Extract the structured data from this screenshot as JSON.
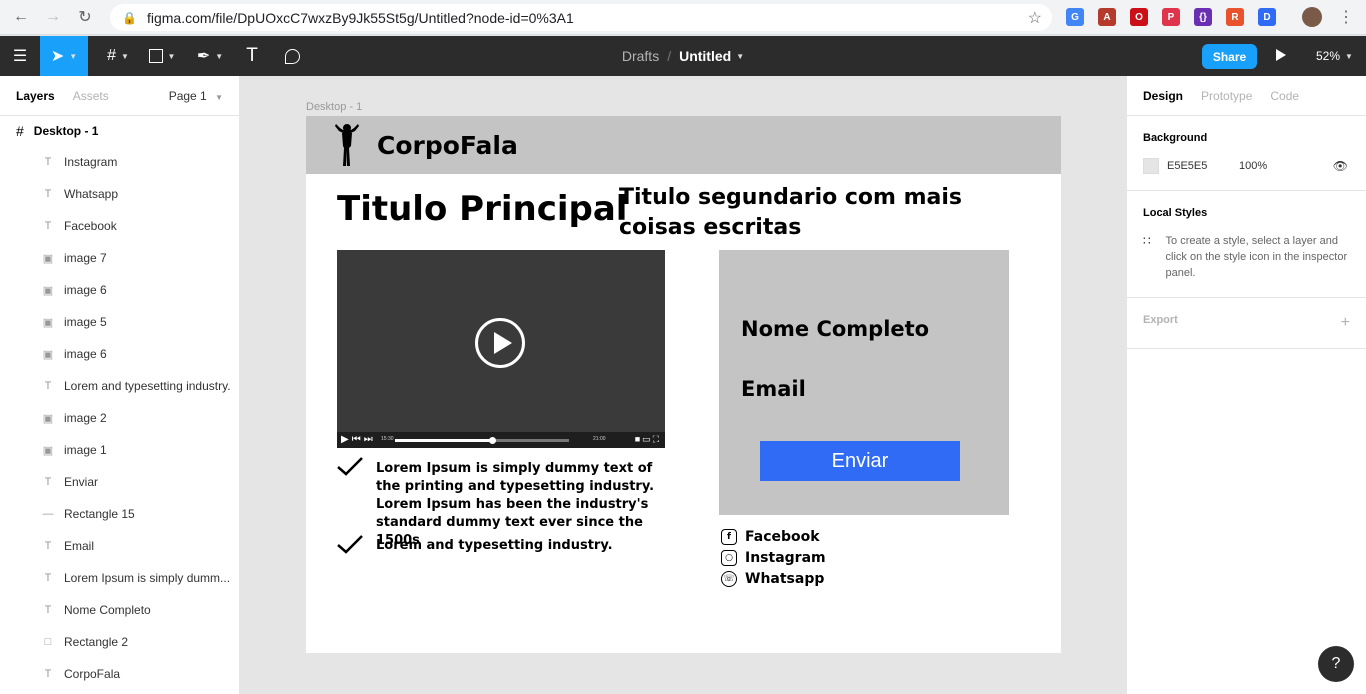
{
  "browser": {
    "url": "figma.com/file/DpUOxcC7wxzBy9Jk55St5g/Untitled?node-id=0%3A1",
    "extensions": [
      {
        "name": "translate-icon",
        "color": "#4285f4",
        "glyph": "G"
      },
      {
        "name": "pdf-icon",
        "color": "#b53a2b",
        "glyph": "A"
      },
      {
        "name": "opera-icon",
        "color": "#cc0f16",
        "glyph": "O"
      },
      {
        "name": "pocket-icon",
        "color": "#e0334c",
        "glyph": "P"
      },
      {
        "name": "json-icon",
        "color": "#6b2fb3",
        "glyph": "{}"
      },
      {
        "name": "rocket-icon",
        "color": "#e8532d",
        "glyph": "R"
      },
      {
        "name": "screen-icon",
        "color": "#2f6bf5",
        "glyph": "D"
      }
    ]
  },
  "toolbar": {
    "drafts": "Drafts",
    "file_title": "Untitled",
    "share_label": "Share",
    "zoom": "52%"
  },
  "left_panel": {
    "tabs": [
      "Layers",
      "Assets"
    ],
    "page": "Page 1",
    "frame": "Desktop - 1",
    "layers": [
      {
        "type": "text",
        "label": "Instagram"
      },
      {
        "type": "text",
        "label": "Whatsapp"
      },
      {
        "type": "text",
        "label": "Facebook"
      },
      {
        "type": "image",
        "label": "image 7"
      },
      {
        "type": "image",
        "label": "image 6"
      },
      {
        "type": "image",
        "label": "image 5"
      },
      {
        "type": "image",
        "label": "image 6"
      },
      {
        "type": "text",
        "label": "Lorem and typesetting industry."
      },
      {
        "type": "image",
        "label": "image 2"
      },
      {
        "type": "image",
        "label": "image 1"
      },
      {
        "type": "text",
        "label": "Enviar"
      },
      {
        "type": "line",
        "label": "Rectangle 15"
      },
      {
        "type": "text",
        "label": "Email"
      },
      {
        "type": "text",
        "label": "Lorem Ipsum is simply dumm..."
      },
      {
        "type": "text",
        "label": "Nome Completo"
      },
      {
        "type": "rect",
        "label": "Rectangle 2"
      },
      {
        "type": "text",
        "label": "CorpoFala"
      }
    ]
  },
  "canvas": {
    "frame_label": "Desktop - 1",
    "brand": "CorpoFala",
    "title_main": "Titulo Principal",
    "title_sub": "Titulo segundario com mais coisas escritas",
    "video": {
      "time_left": "15:30",
      "time_right": "21:00",
      "progress": 0.56
    },
    "bullets": [
      "Lorem Ipsum is simply dummy text of the printing and typesetting industry. Lorem Ipsum has been the industry's standard dummy text ever since the 1500s",
      "Lorem and typesetting industry."
    ],
    "form": {
      "name_label": "Nome Completo",
      "email_label": "Email",
      "submit_label": "Enviar"
    },
    "social": [
      {
        "icon": "facebook-icon",
        "label": "Facebook"
      },
      {
        "icon": "instagram-icon",
        "label": "Instagram"
      },
      {
        "icon": "whatsapp-icon",
        "label": "Whatsapp"
      }
    ]
  },
  "right_panel": {
    "tabs": [
      "Design",
      "Prototype",
      "Code"
    ],
    "background_title": "Background",
    "background_hex": "E5E5E5",
    "background_opacity": "100%",
    "local_styles_title": "Local Styles",
    "local_styles_hint": "To create a style, select a layer and click on the style icon in the inspector panel.",
    "export_title": "Export"
  },
  "help_label": "?"
}
